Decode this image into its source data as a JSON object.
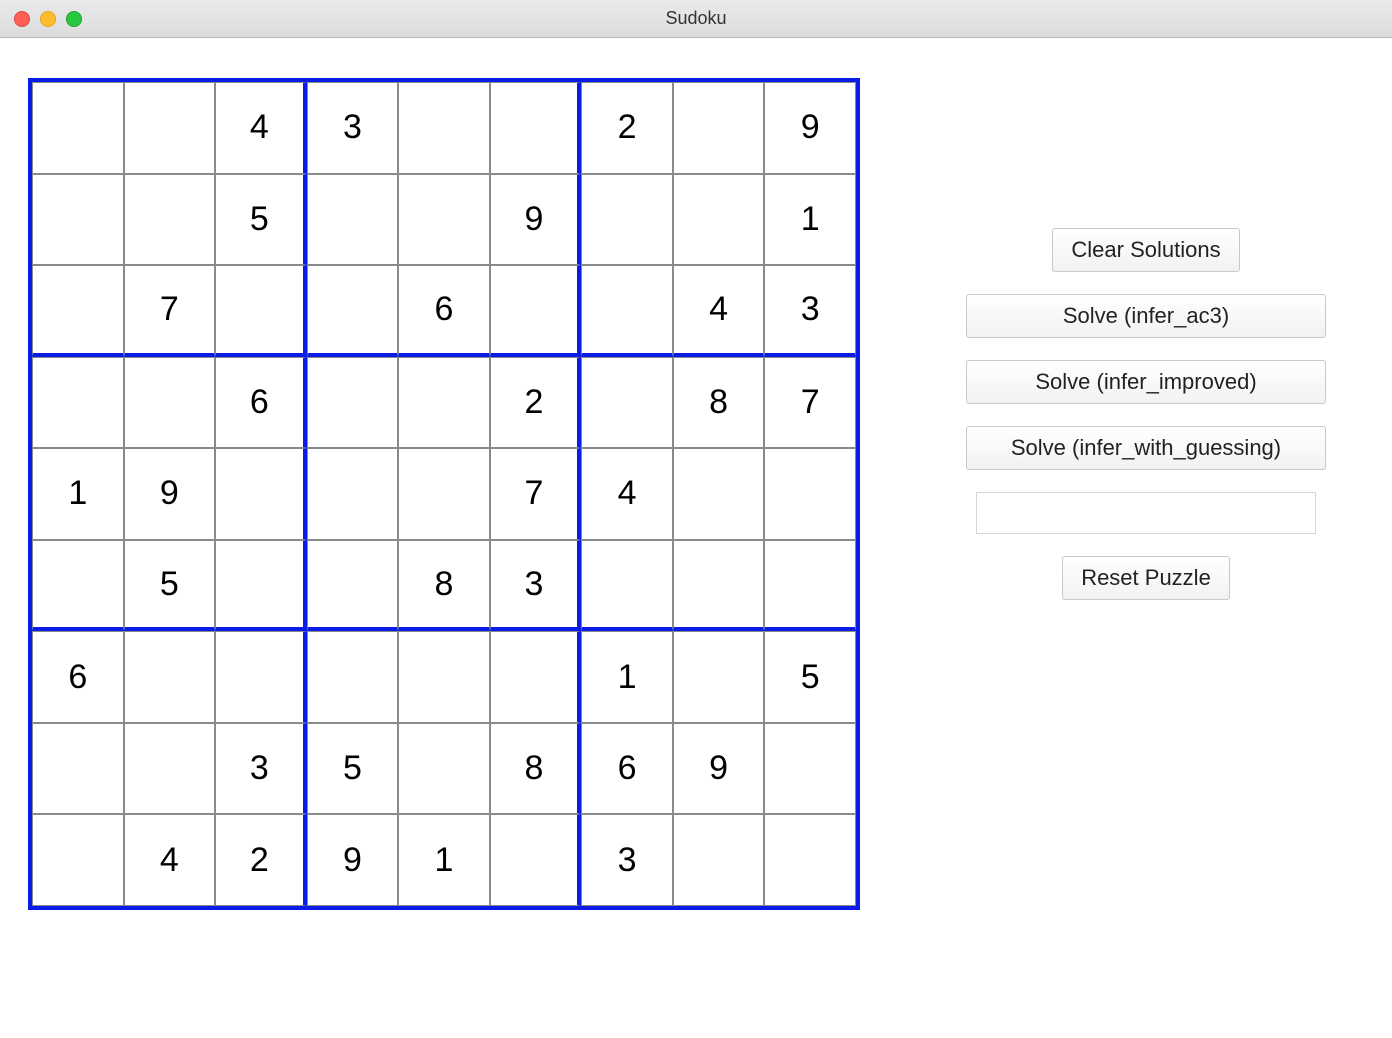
{
  "window": {
    "title": "Sudoku"
  },
  "board": {
    "rows": [
      [
        "",
        "",
        "4",
        "3",
        "",
        "",
        "2",
        "",
        "9"
      ],
      [
        "",
        "",
        "5",
        "",
        "",
        "9",
        "",
        "",
        "1"
      ],
      [
        "",
        "7",
        "",
        "",
        "6",
        "",
        "",
        "4",
        "3"
      ],
      [
        "",
        "",
        "6",
        "",
        "",
        "2",
        "",
        "8",
        "7"
      ],
      [
        "1",
        "9",
        "",
        "",
        "",
        "7",
        "4",
        "",
        ""
      ],
      [
        "",
        "5",
        "",
        "",
        "8",
        "3",
        "",
        "",
        ""
      ],
      [
        "6",
        "",
        "",
        "",
        "",
        "",
        "1",
        "",
        "5"
      ],
      [
        "",
        "",
        "3",
        "5",
        "",
        "8",
        "6",
        "9",
        ""
      ],
      [
        "",
        "4",
        "2",
        "9",
        "1",
        "",
        "3",
        "",
        ""
      ]
    ]
  },
  "sidebar": {
    "clear_label": "Clear Solutions",
    "solve_ac3_label": "Solve (infer_ac3)",
    "solve_improved_label": "Solve (infer_improved)",
    "solve_guessing_label": "Solve (infer_with_guessing)",
    "puzzle_input_value": "",
    "reset_label": "Reset Puzzle"
  }
}
